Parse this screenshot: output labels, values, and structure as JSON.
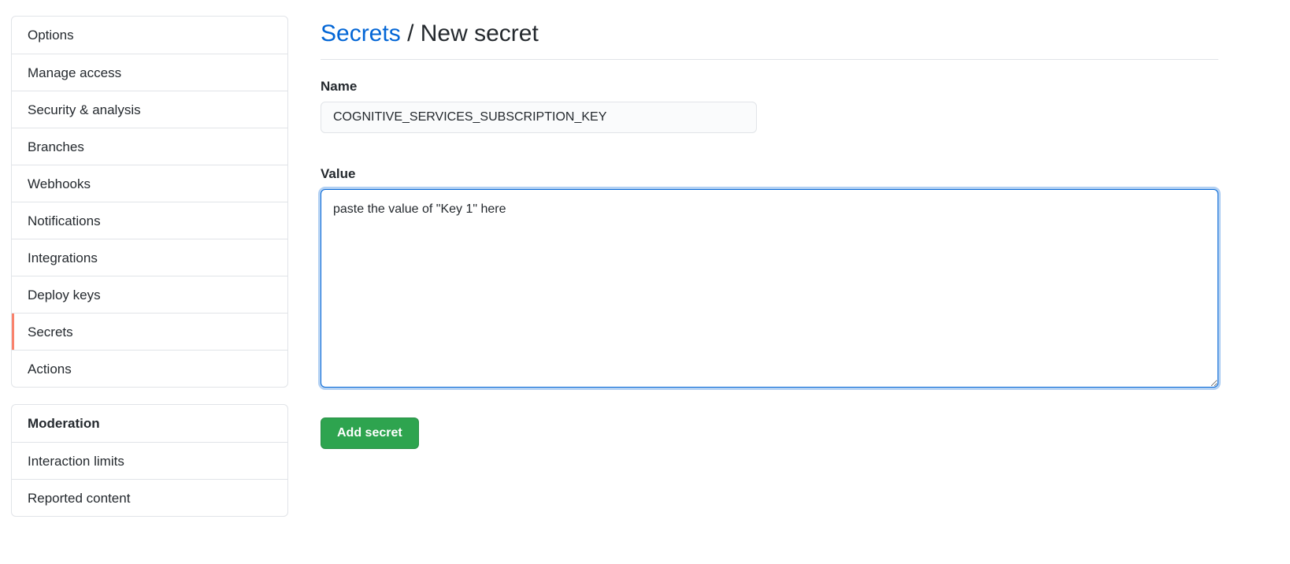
{
  "sidebar": {
    "settings_menu": [
      {
        "label": "Options",
        "selected": false
      },
      {
        "label": "Manage access",
        "selected": false
      },
      {
        "label": "Security & analysis",
        "selected": false
      },
      {
        "label": "Branches",
        "selected": false
      },
      {
        "label": "Webhooks",
        "selected": false
      },
      {
        "label": "Notifications",
        "selected": false
      },
      {
        "label": "Integrations",
        "selected": false
      },
      {
        "label": "Deploy keys",
        "selected": false
      },
      {
        "label": "Secrets",
        "selected": true
      },
      {
        "label": "Actions",
        "selected": false
      }
    ],
    "moderation": {
      "heading": "Moderation",
      "items": [
        {
          "label": "Interaction limits"
        },
        {
          "label": "Reported content"
        }
      ]
    }
  },
  "header": {
    "breadcrumb_link": "Secrets",
    "separator": "/",
    "current": "New secret"
  },
  "form": {
    "name_label": "Name",
    "name_value": "COGNITIVE_SERVICES_SUBSCRIPTION_KEY",
    "value_label": "Value",
    "value_text": "paste the value of \"Key 1\" here",
    "submit_label": "Add secret"
  },
  "colors": {
    "link": "#0366d6",
    "selected_indicator": "#f9826c",
    "primary_button": "#2ea44f"
  }
}
